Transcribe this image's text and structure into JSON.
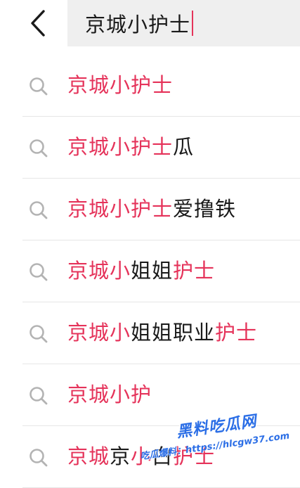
{
  "header": {
    "back_icon": "chevron-left-icon",
    "search_value": "京城小护士"
  },
  "suggestions": [
    {
      "parts": [
        {
          "text": "京城小护士",
          "hl": true
        }
      ]
    },
    {
      "parts": [
        {
          "text": "京城小护士",
          "hl": true
        },
        {
          "text": "瓜",
          "hl": false
        }
      ]
    },
    {
      "parts": [
        {
          "text": "京城小护士",
          "hl": true
        },
        {
          "text": "爱撸铁",
          "hl": false
        }
      ]
    },
    {
      "parts": [
        {
          "text": "京城小",
          "hl": true
        },
        {
          "text": "姐姐",
          "hl": false
        },
        {
          "text": "护士",
          "hl": true
        }
      ]
    },
    {
      "parts": [
        {
          "text": "京城小",
          "hl": true
        },
        {
          "text": "姐姐职业",
          "hl": false
        },
        {
          "text": "护士",
          "hl": true
        }
      ]
    },
    {
      "parts": [
        {
          "text": "京城小护",
          "hl": true
        }
      ]
    },
    {
      "parts": [
        {
          "text": "京城",
          "hl": true
        },
        {
          "text": "京",
          "hl": false
        },
        {
          "text": "小",
          "hl": true
        },
        {
          "text": "白",
          "hl": false
        },
        {
          "text": "护士",
          "hl": true
        }
      ]
    }
  ],
  "icons": {
    "suggestion_icon": "search-icon"
  },
  "watermark": {
    "logo": "黑料吃瓜网",
    "url": "吃瓜爆料：https://hlcgw37.com"
  },
  "colors": {
    "highlight": "#e5335a",
    "text": "#1a1a1a",
    "search_bg": "#efefef",
    "divider": "#e6e6e6",
    "watermark": "#2b6ee6"
  }
}
